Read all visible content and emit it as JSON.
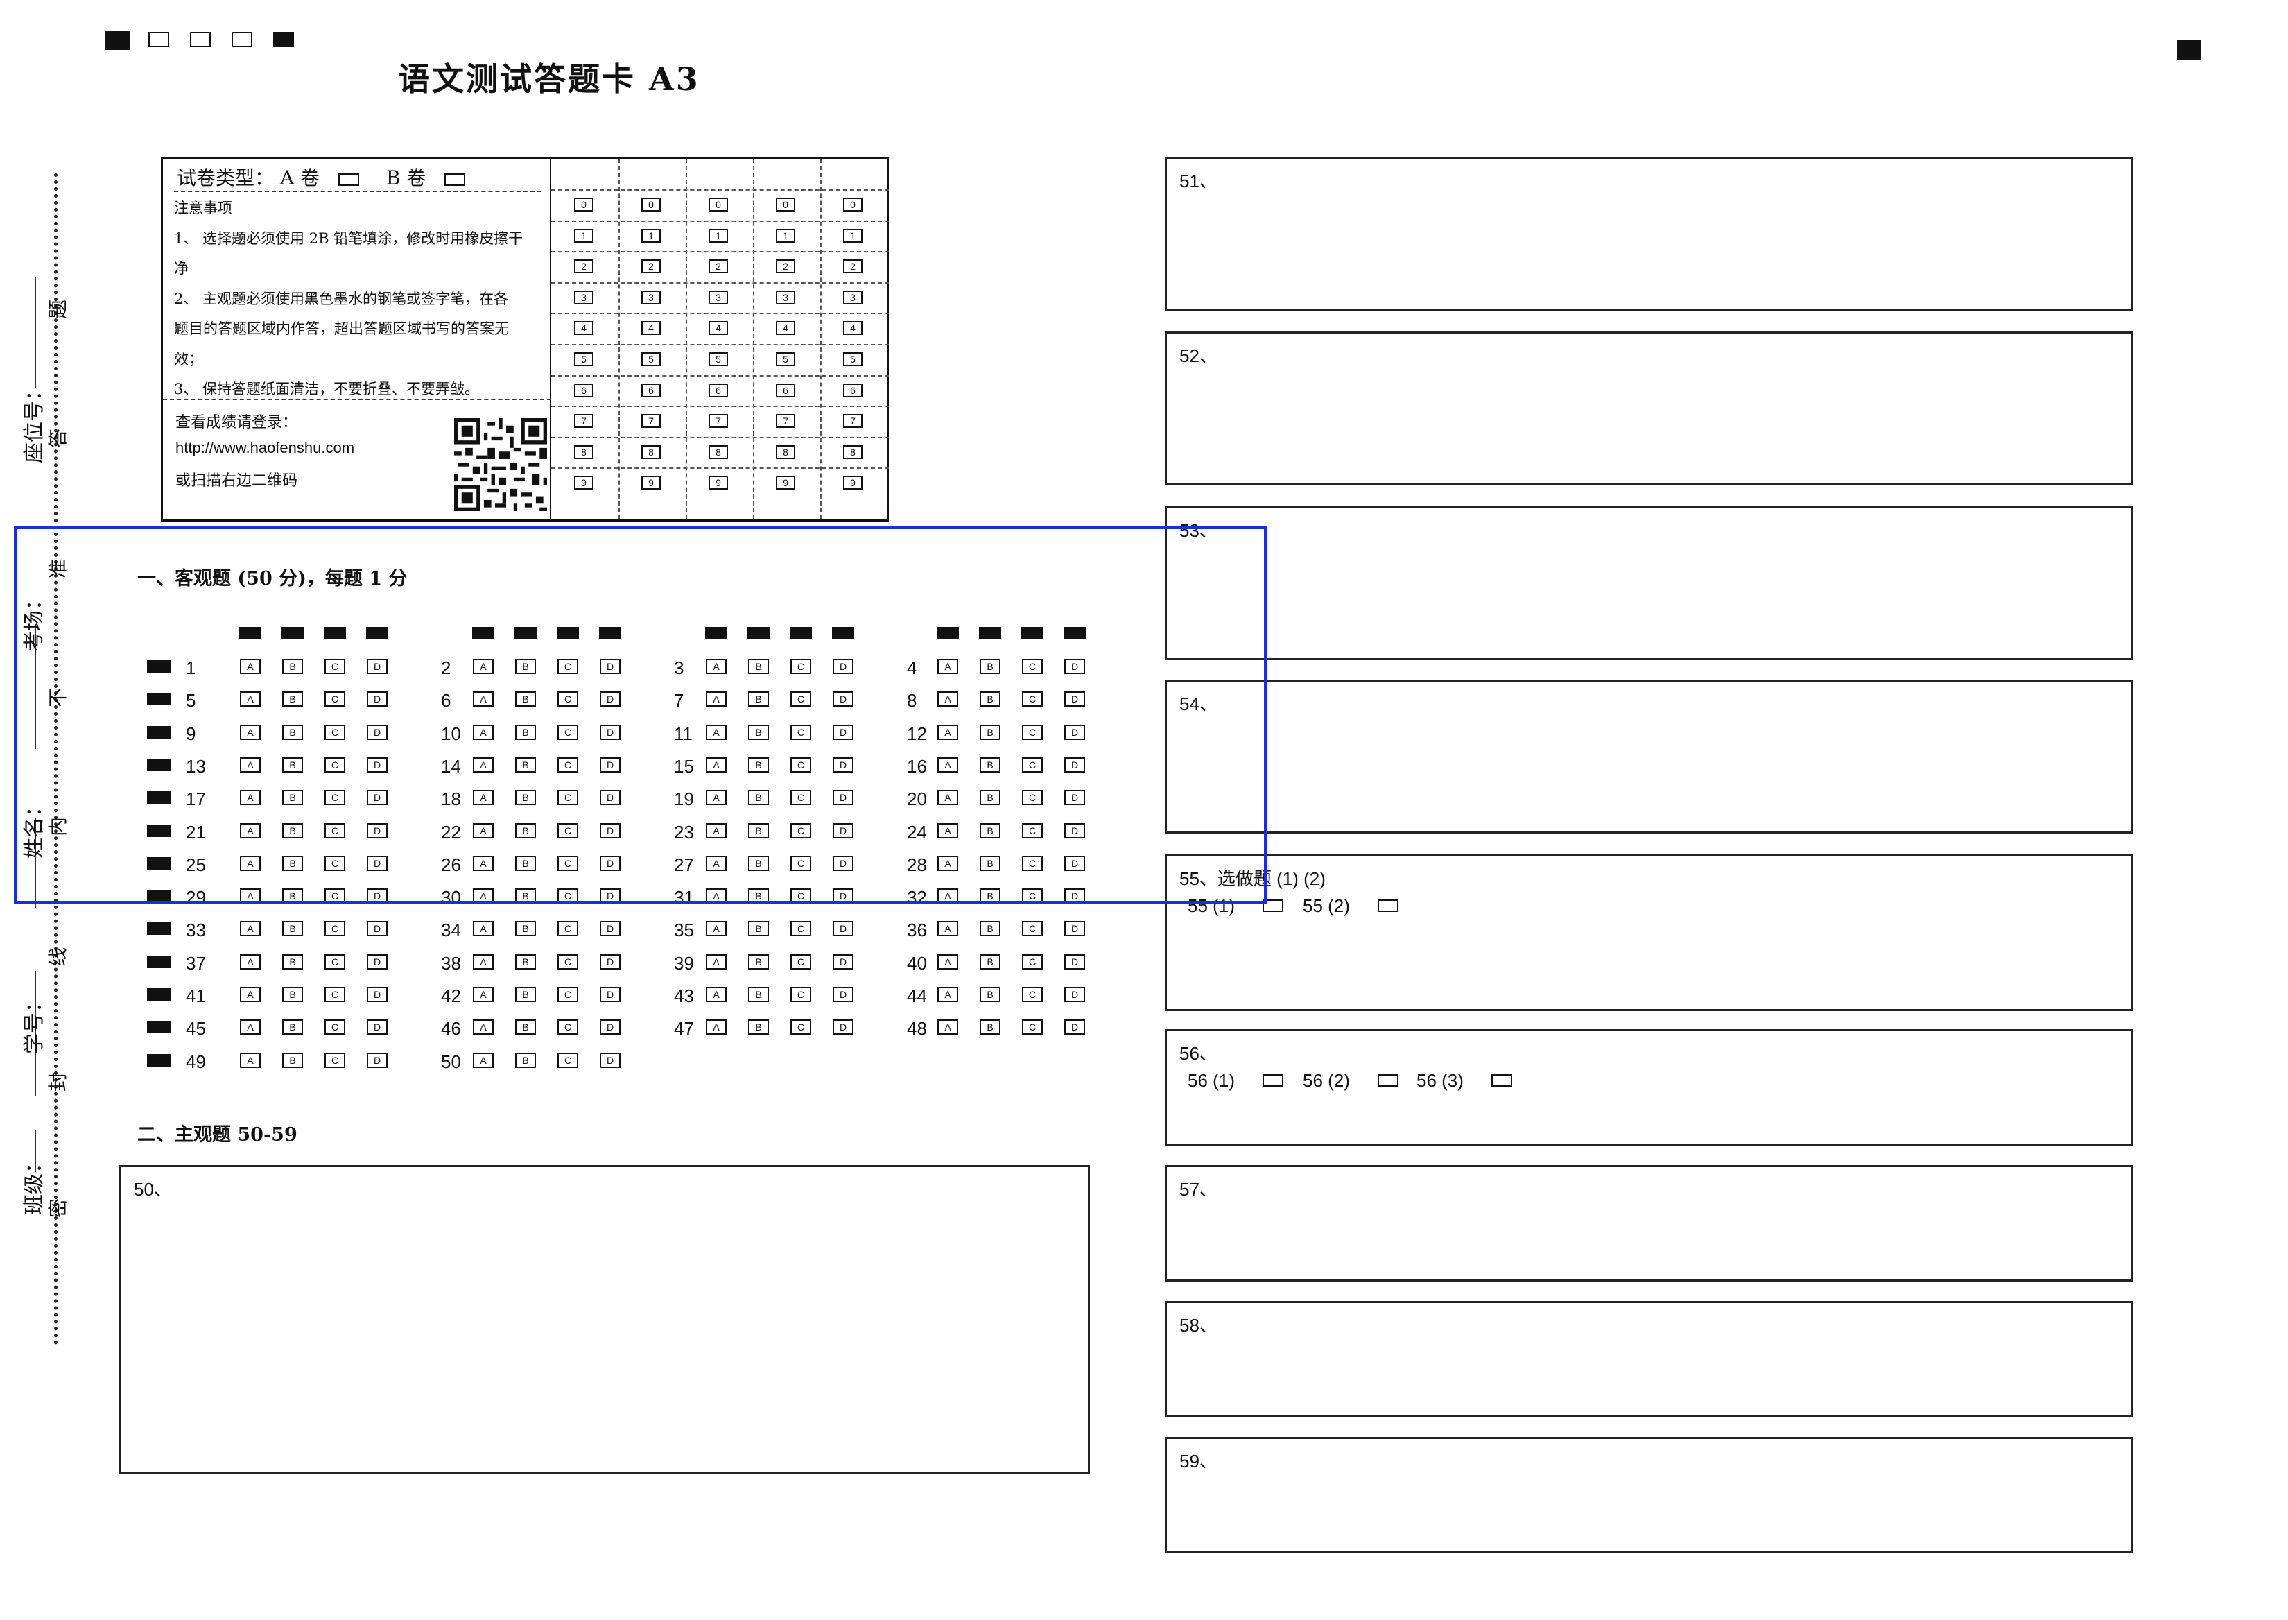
{
  "header": {
    "title": "语文测试答题卡 A3"
  },
  "binding_strip": {
    "labels": [
      "座位号：",
      "考场：",
      "姓名：",
      "学号：",
      "班级："
    ],
    "seal_chars": [
      "题",
      "答",
      "准",
      "不",
      "内",
      "线",
      "封",
      "密"
    ]
  },
  "info": {
    "paper_type_label": "试卷类型：",
    "paper_a": "A 卷",
    "paper_b": "B 卷",
    "notes_title": "注意事项",
    "notes": [
      "1、 选择题必须使用 2B 铅笔填涂，修改时用橡皮擦干",
      "净",
      "2、 主观题必须使用黑色墨水的钢笔或签字笔，在各",
      "题目的答题区域内作答，超出答题区域书写的答案无",
      "效；",
      "3、 保持答题纸面清洁，不要折叠、不要弄皱。"
    ],
    "score_title": "查看成绩请登录：",
    "score_url": "http://www.haofenshu.com",
    "score_qr_hint": "或扫描右边二维码"
  },
  "digits": [
    "0",
    "1",
    "2",
    "3",
    "4",
    "5",
    "6",
    "7",
    "8",
    "9"
  ],
  "objective": {
    "title": "一、客观题 (50 分)，每题 1 分",
    "options": [
      "A",
      "B",
      "C",
      "D"
    ],
    "rows": [
      [
        "1",
        "2",
        "3",
        "4"
      ],
      [
        "5",
        "6",
        "7",
        "8"
      ],
      [
        "9",
        "10",
        "11",
        "12"
      ],
      [
        "13",
        "14",
        "15",
        "16"
      ],
      [
        "17",
        "18",
        "19",
        "20"
      ],
      [
        "21",
        "22",
        "23",
        "24"
      ],
      [
        "25",
        "26",
        "27",
        "28"
      ],
      [
        "29",
        "30",
        "31",
        "32"
      ],
      [
        "33",
        "34",
        "35",
        "36"
      ],
      [
        "37",
        "38",
        "39",
        "40"
      ],
      [
        "41",
        "42",
        "43",
        "44"
      ],
      [
        "45",
        "46",
        "47",
        "48"
      ],
      [
        "49",
        "50"
      ]
    ]
  },
  "subjective": {
    "title": "二、主观题 50-59",
    "q50": "50、",
    "right_boxes": [
      "51、",
      "52、",
      "53、",
      "54、",
      "55、选做题 (1) (2)",
      "56、",
      "57、",
      "58、",
      "59、"
    ],
    "q55_choices": [
      "55 (1)",
      "55 (2)"
    ],
    "q56_choices": [
      "56 (1)",
      "56 (2)",
      "56 (3)"
    ]
  },
  "colors": {
    "overlay_blue": "#1a2fd4",
    "ink": "#111111"
  }
}
